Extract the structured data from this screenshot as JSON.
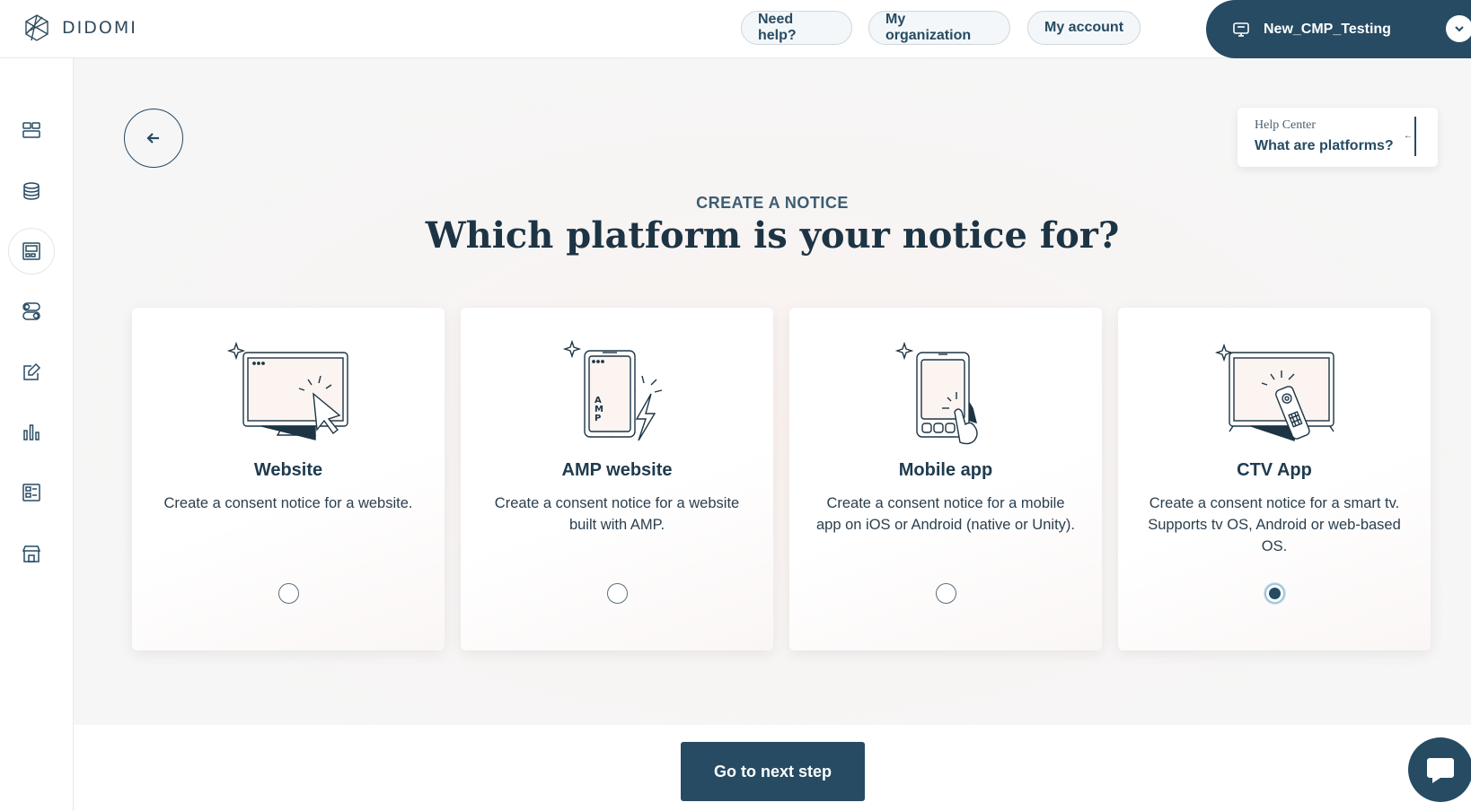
{
  "brand": {
    "name": "DIDOMI"
  },
  "header": {
    "help_label": "Need help?",
    "org_label": "My organization",
    "account_label": "My account",
    "org_switcher": "New_CMP_Testing"
  },
  "sidebar": {
    "items": [
      {
        "icon": "dashboard-icon"
      },
      {
        "icon": "database-icon"
      },
      {
        "icon": "notices-icon",
        "active": true
      },
      {
        "icon": "toggles-icon"
      },
      {
        "icon": "edit-icon"
      },
      {
        "icon": "analytics-icon"
      },
      {
        "icon": "reports-icon"
      },
      {
        "icon": "marketplace-icon"
      }
    ]
  },
  "help_center": {
    "label": "Help Center",
    "link": "What are platforms?"
  },
  "page": {
    "eyebrow": "CREATE A NOTICE",
    "title": "Which platform is your notice for?"
  },
  "platforms": [
    {
      "title": "Website",
      "description": "Create a consent notice for a website.",
      "selected": false,
      "icon": "website-icon"
    },
    {
      "title": "AMP website",
      "description": "Create a consent notice for a website built with AMP.",
      "selected": false,
      "icon": "amp-icon",
      "amp_letters": [
        "A",
        "M",
        "P"
      ]
    },
    {
      "title": "Mobile app",
      "description": "Create a consent notice for a mobile app on iOS or Android (native or Unity).",
      "selected": false,
      "icon": "mobile-app-icon"
    },
    {
      "title": "CTV App",
      "description": "Create a consent notice for a smart tv. Supports tv OS, Android or web-based OS.",
      "selected": true,
      "icon": "ctv-icon"
    }
  ],
  "footer": {
    "next_label": "Go to next step"
  },
  "colors": {
    "primary": "#264b63",
    "text": "#1f3b4e",
    "background": "#f6f6f7"
  }
}
